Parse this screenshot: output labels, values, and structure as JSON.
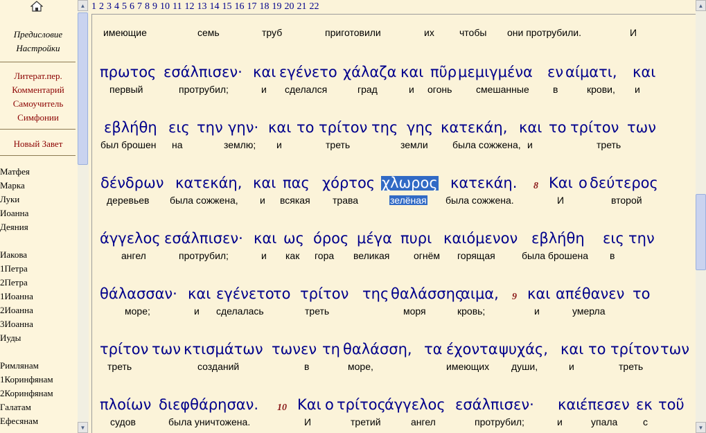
{
  "nav": {
    "top_items": [
      "Предисловие",
      "Настройки"
    ],
    "menu_items": [
      "Литерат.пер.",
      "Комментарий",
      "Самоучитель",
      "Симфонии"
    ],
    "testament": "Новый Завет",
    "books": [
      "Матфея",
      "Марка",
      "Луки",
      "Иоанна",
      "Деяния",
      "Иакова",
      "1Петра",
      "2Петра",
      "1Иоанна",
      "2Иоанна",
      "3Иоанна",
      "Иуды",
      "Римлянам",
      "1Коринфянам",
      "2Коринфянам",
      "Галатам",
      "Ефесянам"
    ]
  },
  "chapters": [
    "1",
    "2",
    "3",
    "4",
    "5",
    "6",
    "7",
    "8",
    "9",
    "10",
    "11",
    "12",
    "13",
    "14",
    "15",
    "16",
    "17",
    "18",
    "19",
    "20",
    "21",
    "22"
  ],
  "lines": [
    {
      "greek": [],
      "ru": [
        "имеющие",
        "семь",
        "труб",
        "приготовили",
        "их",
        "чтобы",
        "они протрубили.",
        "И"
      ]
    },
    {
      "greek": [
        "πρωτος",
        "εσάλπισεν·",
        "και",
        "εγένετο",
        "χάλαζα",
        "και",
        "πῦρ",
        "μεμιγμένα",
        "εν",
        "αίματι,",
        "και"
      ],
      "ru": [
        "первый",
        "протрубил;",
        "и",
        "сделался",
        "град",
        "и",
        "огонь",
        "смешанные",
        "в",
        "крови,",
        "и"
      ]
    },
    {
      "greek": [
        "εβλήθη",
        "εις",
        "την",
        "γην·",
        "και",
        "το",
        "τρίτον",
        "της",
        "γης",
        "κατεκάη,",
        "και",
        "το",
        "τρίτον",
        "των"
      ],
      "ru": [
        "был брошен",
        "на",
        "землю;",
        "и",
        "треть",
        "земли",
        "была сожжена,",
        "и",
        "треть"
      ]
    },
    {
      "greek": [
        "δένδρων",
        "κατεκάη,",
        "και",
        "πας",
        "χόρτος",
        "χλωρος",
        "κατεκάη.",
        "Και",
        "ο",
        "δεύτερος"
      ],
      "ru": [
        "деревьев",
        "была сожжена,",
        "и",
        "всякая",
        "трава",
        "зелёная",
        "была сожжена.",
        "И",
        "второй"
      ],
      "verse": "8"
    },
    {
      "greek": [
        "άγγελος",
        "εσάλπισεν·",
        "και",
        "ως",
        "όρος",
        "μέγα",
        "πυρι",
        "καιόμενον",
        "εβλήθη",
        "εις",
        "την"
      ],
      "ru": [
        "ангел",
        "протрубил;",
        "и",
        "как",
        "гора",
        "великая",
        "огнём",
        "горящая",
        "была брошена",
        "в"
      ]
    },
    {
      "greek": [
        "θάλασσαν·",
        "και",
        "εγένετο",
        "το",
        "τρίτον",
        "της",
        "θαλάσσης",
        "αιμα,",
        "και",
        "απέθανεν",
        "το"
      ],
      "ru": [
        "море;",
        "и",
        "сделалась",
        "треть",
        "моря",
        "кровь;",
        "и",
        "умерла"
      ],
      "verse": "9"
    },
    {
      "greek": [
        "τρίτον",
        "των",
        "κτισμάτων",
        "των",
        "εν",
        "τη",
        "θαλάσση,",
        "τα",
        "έχοντα",
        "ψυχάς,",
        "και",
        "το",
        "τρίτον",
        "των"
      ],
      "ru": [
        "треть",
        "созданий",
        "в",
        "море,",
        "имеющих",
        "души,",
        "и",
        "треть"
      ]
    },
    {
      "greek": [
        "πλοίων",
        "διεφθάρησαν.",
        "Και",
        "ο",
        "τρίτος",
        "άγγελος",
        "εσάλπισεν·",
        "και",
        "έπεσεν",
        "εκ",
        "τοῦ"
      ],
      "ru": [
        "судов",
        "была уничтожена.",
        "И",
        "третий",
        "ангел",
        "протрубил;",
        "и",
        "упала",
        "с"
      ],
      "verse": "10"
    }
  ]
}
